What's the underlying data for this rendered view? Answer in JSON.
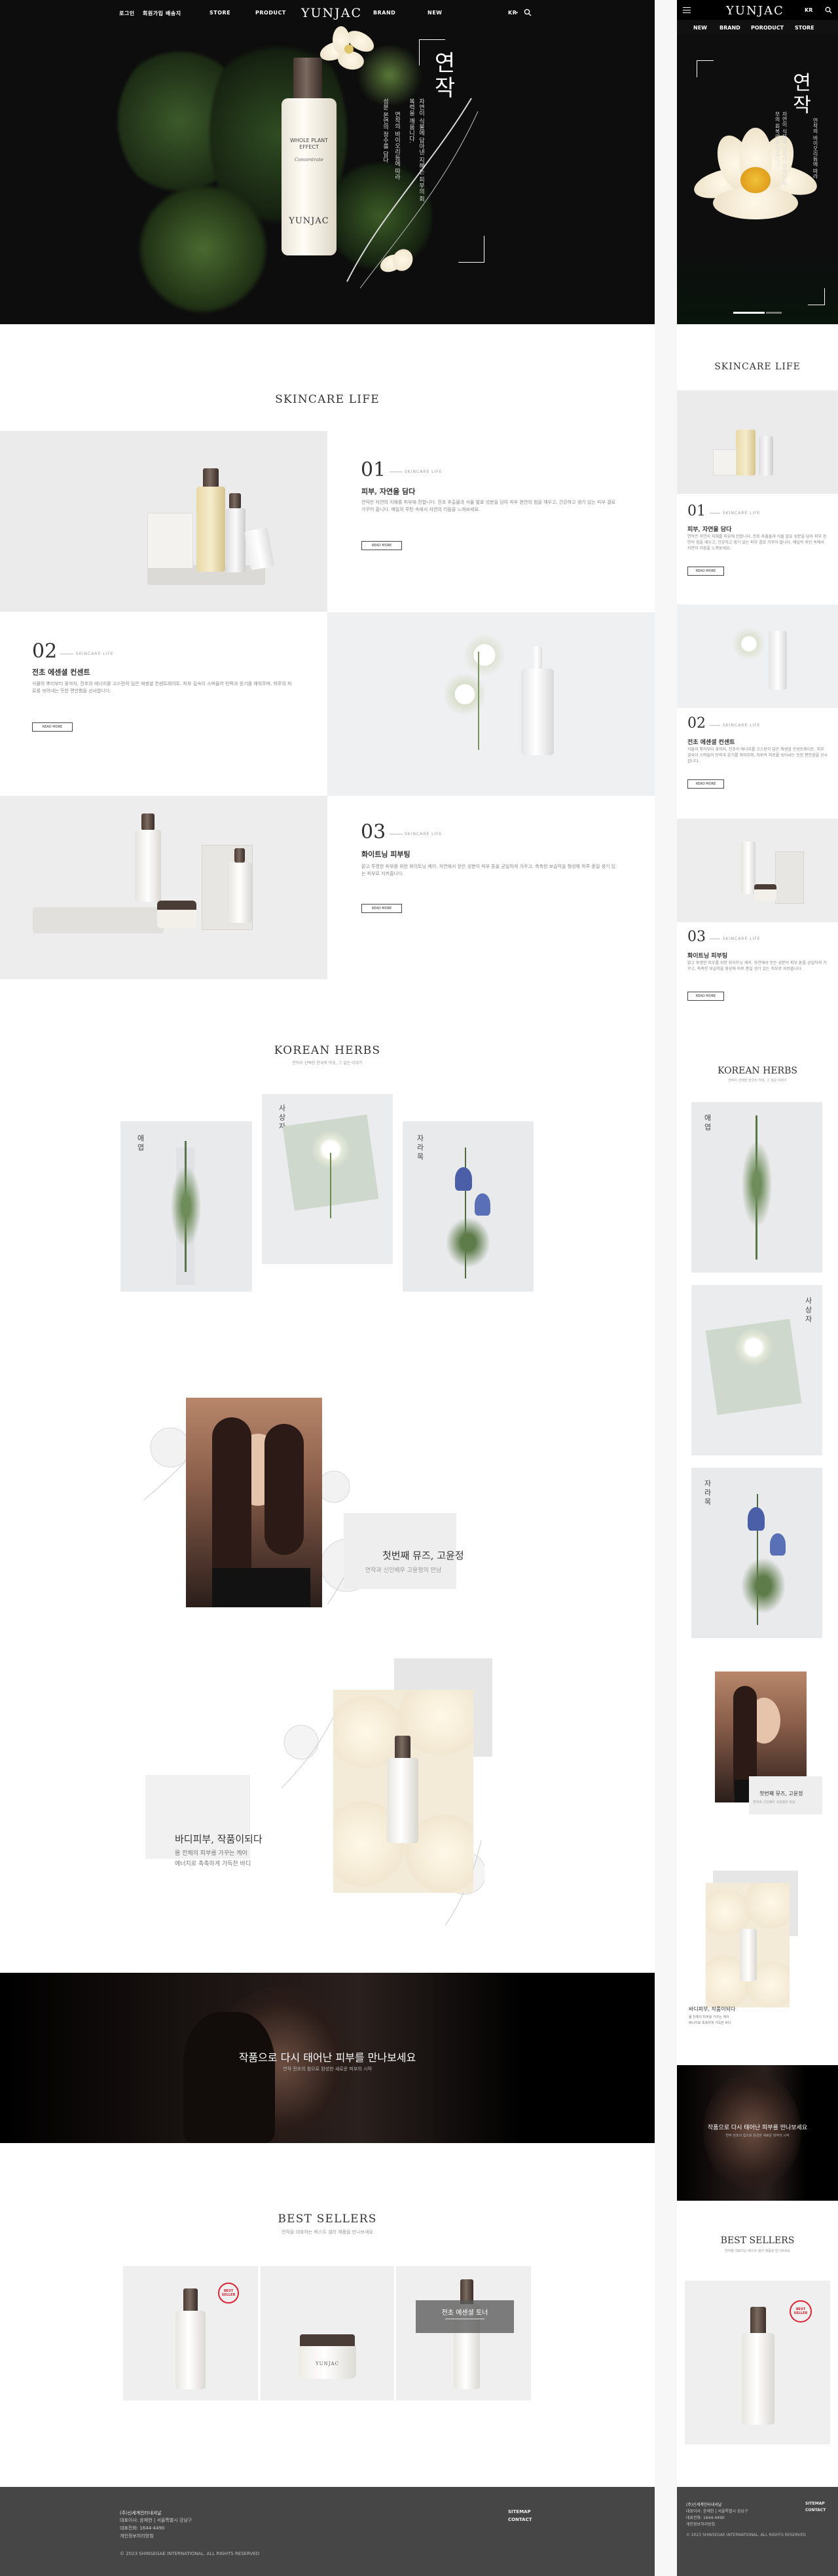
{
  "brand": {
    "logo": "YUNJAC",
    "colors": {
      "hero_bg": "#0d0d0d",
      "footer_bg": "#464646",
      "accent_stamp": "#dd2233"
    }
  },
  "nav": {
    "left": [
      "로그인",
      "회원가입",
      "배송지"
    ],
    "items": [
      "STORE",
      "PRODUCT",
      "BRAND",
      "NEW"
    ],
    "lang": "KR",
    "search_icon": "search-icon"
  },
  "hero": {
    "title": "연작",
    "caption_lines": [
      "자연이 식물에 담아낸 지혜는 피부의 회복력을 깨웁니다.",
      "연작의 바이오리듬에 따라",
      "성분 본연의 정수를 담다"
    ],
    "bottle_label_top": "WHOLE PLANT EFFECT",
    "bottle_label_sub": "Concentrate",
    "bottle_brand": "YUNJAC"
  },
  "skincare": {
    "title": "SKINCARE LIFE",
    "items": [
      {
        "num": "01",
        "tag": "SKINCARE LIFE",
        "heading": "피부, 자연을 담다",
        "text": "연작은 자연의 지혜를 피부에 전합니다. 전초 추출물과 식물 발효 성분을 담아 피부 본연의 힘을 깨우고, 건강하고 생기 있는 피부 결로 가꾸어 줍니다. 매일의 루틴 속에서 자연의 리듬을 느껴보세요.",
        "btn": "READ MORE"
      },
      {
        "num": "02",
        "tag": "SKINCARE LIFE",
        "heading": "전초 에센셜 컨센트",
        "text": "식물의 뿌리부터 꽃까지, 전초의 에너지를 고스란히 담은 에센셜 컨센트레이트. 피부 깊숙이 스며들어 탄력과 윤기를 채워주며, 하루의 피로를 씻어내는 듯한 편안함을 선사합니다.",
        "btn": "READ MORE"
      },
      {
        "num": "03",
        "tag": "SKINCARE LIFE",
        "heading": "화이트닝 피부팅",
        "text": "맑고 투명한 피부를 위한 화이트닝 케어. 자연에서 얻은 성분이 피부 톤을 균일하게 가꾸고, 촉촉한 보습막을 형성해 하루 종일 생기 있는 피부로 지켜줍니다.",
        "btn": "READ MORE"
      }
    ]
  },
  "herbs": {
    "title": "KOREAN HERBS",
    "subtitle": "연작이 선택한 한국의 약초, 그 깊은 이야기",
    "items": [
      {
        "name": "애엽"
      },
      {
        "name": "사상자"
      },
      {
        "name": "자라목"
      }
    ]
  },
  "story1": {
    "heading": "첫번째 뮤즈, 고윤정",
    "sub": "연작과 신인배우 고윤정의 만남"
  },
  "story2": {
    "heading": "바디피부, 작품이되다",
    "lines": [
      "몸 전체의 피부를 가꾸는 케어",
      "에너지로 촉촉하게 가득찬 바디"
    ]
  },
  "banner": {
    "heading": "작품으로 다시 태어난 피부를 만나보세요",
    "sub": "연작 전초의 힘으로 완성한 새로운 피부의 시작"
  },
  "bestsellers": {
    "title": "BEST SELLERS",
    "subtitle": "연작을 대표하는 베스트 셀러 제품을 만나보세요",
    "overlay_title": "전초 에센셜 토너",
    "stamp": "BEST SELLER",
    "jar_label": "YUNJAC"
  },
  "footer": {
    "lines": [
      "(주)신세계인터내셔날",
      "대표이사: 윤제헌 | 서울특별시 강남구",
      "대표전화: 1644-4490",
      "개인정보처리방침"
    ],
    "links": [
      "SITEMAP",
      "CONTACT"
    ],
    "copyright": "© 2023 SHINSEGAE INTERNATIONAL. ALL RIGHTS RESERVED"
  },
  "mobile": {
    "nav_items": [
      "NEW",
      "BRAND",
      "PORODUCT",
      "STORE"
    ],
    "menu_icon": "hamburger-icon"
  }
}
